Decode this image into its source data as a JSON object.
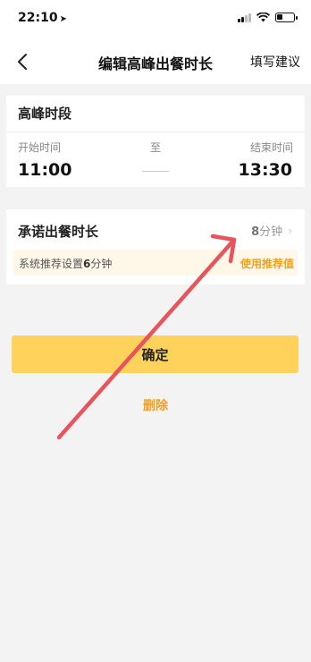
{
  "status_bar": {
    "time": "22:10",
    "location_glyph": "➤",
    "signal_bars": 2,
    "battery_level": 0.3
  },
  "nav": {
    "title": "编辑高峰出餐时长",
    "action": "填写建议",
    "back_icon": "chevron-left-icon"
  },
  "peak": {
    "title": "高峰时段",
    "start_label": "开始时间",
    "to_label": "至",
    "end_label": "结束时间",
    "start_time": "11:00",
    "end_time": "13:30"
  },
  "commit": {
    "label": "承诺出餐时长",
    "value_number": "8",
    "value_unit": "分钟",
    "chevron": "›",
    "suggest_prefix": "系统推荐设置",
    "suggest_number": "6",
    "suggest_unit": "分钟",
    "apply_label": "使用推荐值"
  },
  "actions": {
    "confirm": "确定",
    "delete": "删除"
  },
  "colors": {
    "accent": "#ffd25c",
    "link": "#f0a120",
    "annotation": "#e8545c"
  }
}
